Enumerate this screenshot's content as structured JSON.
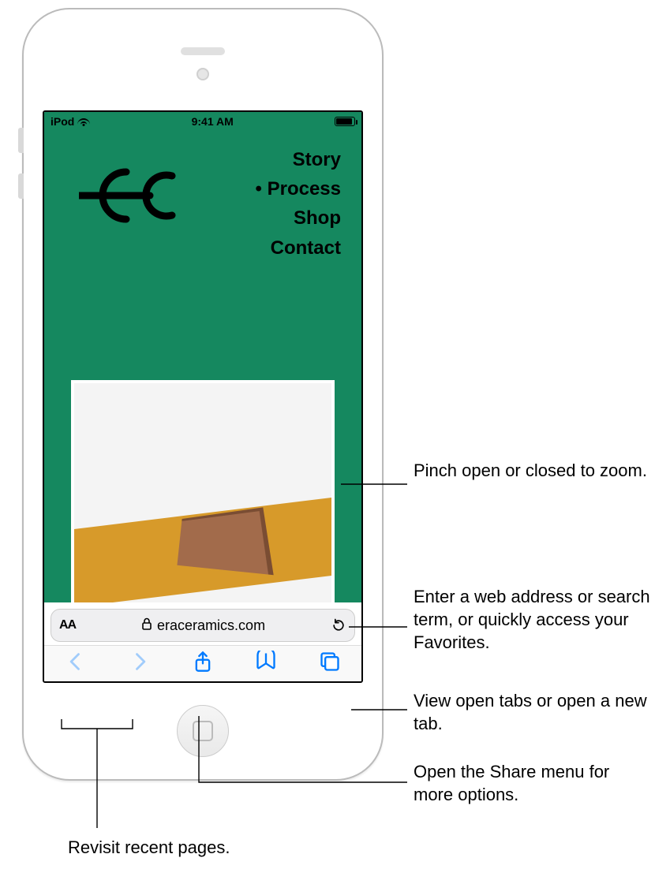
{
  "statusbar": {
    "carrier": "iPod",
    "time": "9:41 AM"
  },
  "webpage": {
    "nav": {
      "story": "Story",
      "process": "Process",
      "shop": "Shop",
      "contact": "Contact"
    }
  },
  "addressbar": {
    "url": "eraceramics.com"
  },
  "callouts": {
    "zoom": "Pinch open or closed to zoom.",
    "search": "Enter a web address or search term, or quickly access your Favorites.",
    "tabs": "View open tabs or open a new tab.",
    "share": "Open the Share menu for more options.",
    "history": "Revisit recent pages."
  }
}
